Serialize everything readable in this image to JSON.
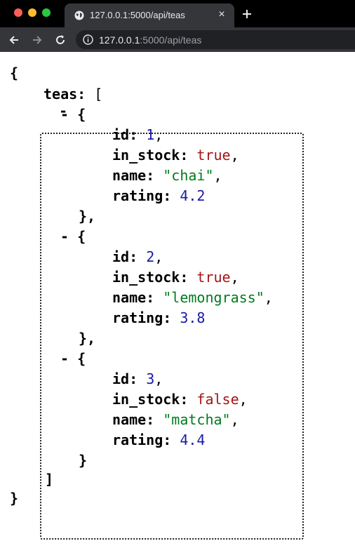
{
  "browser": {
    "tab_title": "127.0.0.1:5000/api/teas",
    "url_host": "127.0.0.1",
    "url_rest": ":5000/api/teas",
    "tab_close": "×"
  },
  "json_view": {
    "open_brace": "{",
    "close_brace": "}",
    "collapse_toggle": "-",
    "root_key": "teas",
    "open_bracket": "[",
    "close_bracket": "]",
    "items": [
      {
        "id": "1",
        "in_stock": "true",
        "name": "\"chai\"",
        "rating": "4.2",
        "close": "},"
      },
      {
        "id": "2",
        "in_stock": "true",
        "name": "\"lemongrass\"",
        "rating": "3.8",
        "close": "},"
      },
      {
        "id": "3",
        "in_stock": "false",
        "name": "\"matcha\"",
        "rating": "4.4",
        "close": "}"
      }
    ],
    "keys": {
      "id": "id",
      "in_stock": "in_stock",
      "name": "name",
      "rating": "rating"
    }
  }
}
